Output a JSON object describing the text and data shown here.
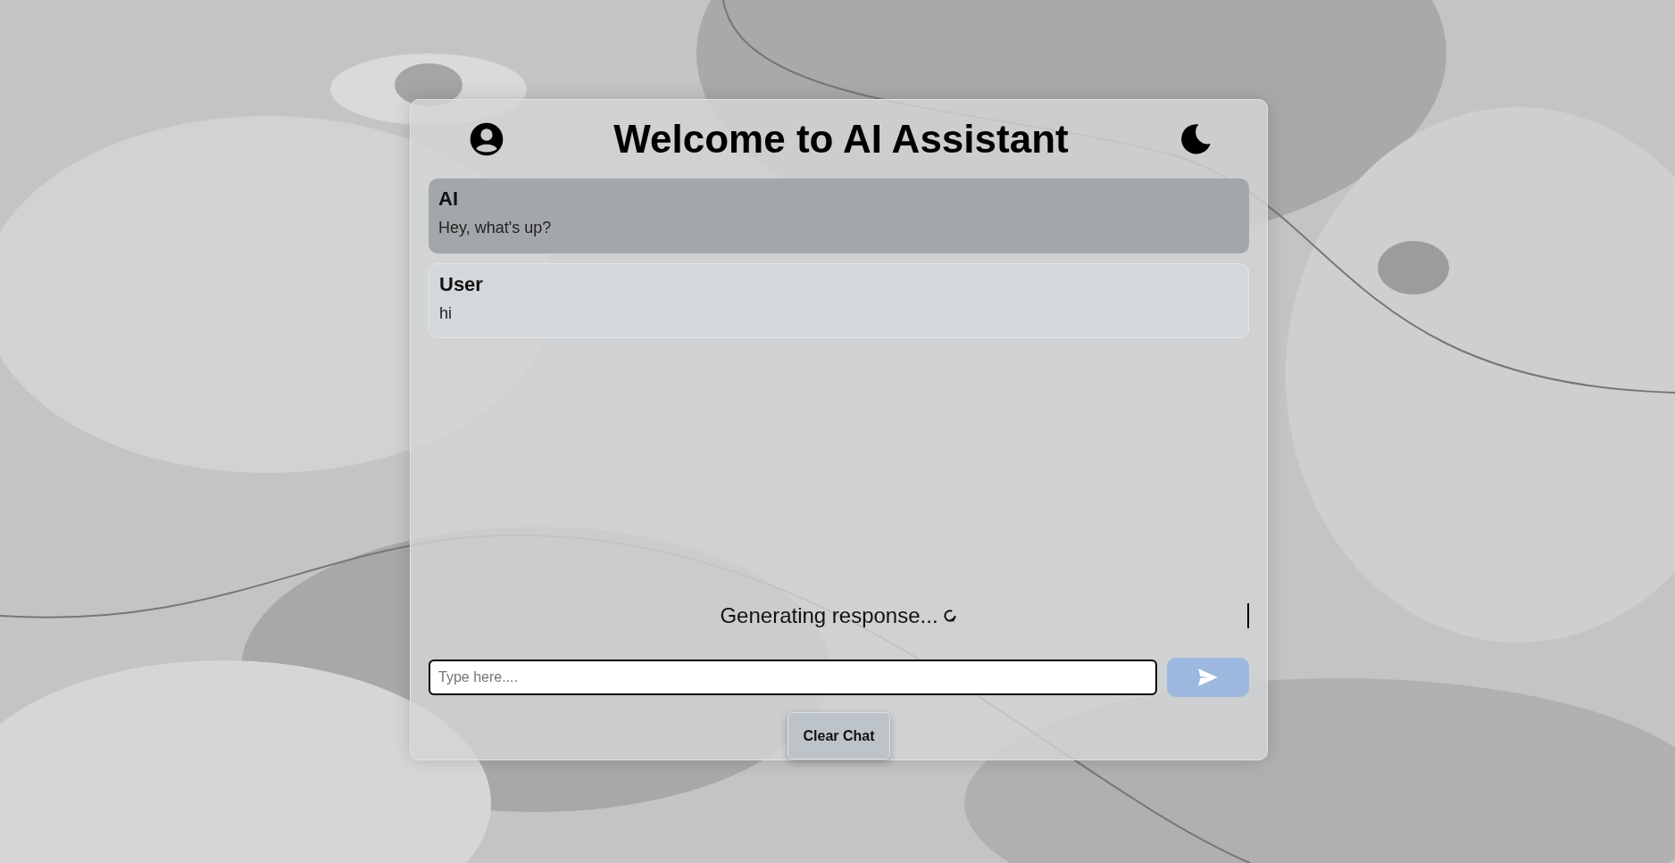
{
  "header": {
    "title": "Welcome to AI Assistant"
  },
  "messages": [
    {
      "kind": "ai",
      "sender": "AI",
      "text": "Hey, what's up?"
    },
    {
      "kind": "user",
      "sender": "User",
      "text": "hi"
    }
  ],
  "status": {
    "text": "Generating response...",
    "loading": true
  },
  "composer": {
    "placeholder": "Type here....",
    "send_disabled": true
  },
  "actions": {
    "clear_label": "Clear Chat"
  }
}
